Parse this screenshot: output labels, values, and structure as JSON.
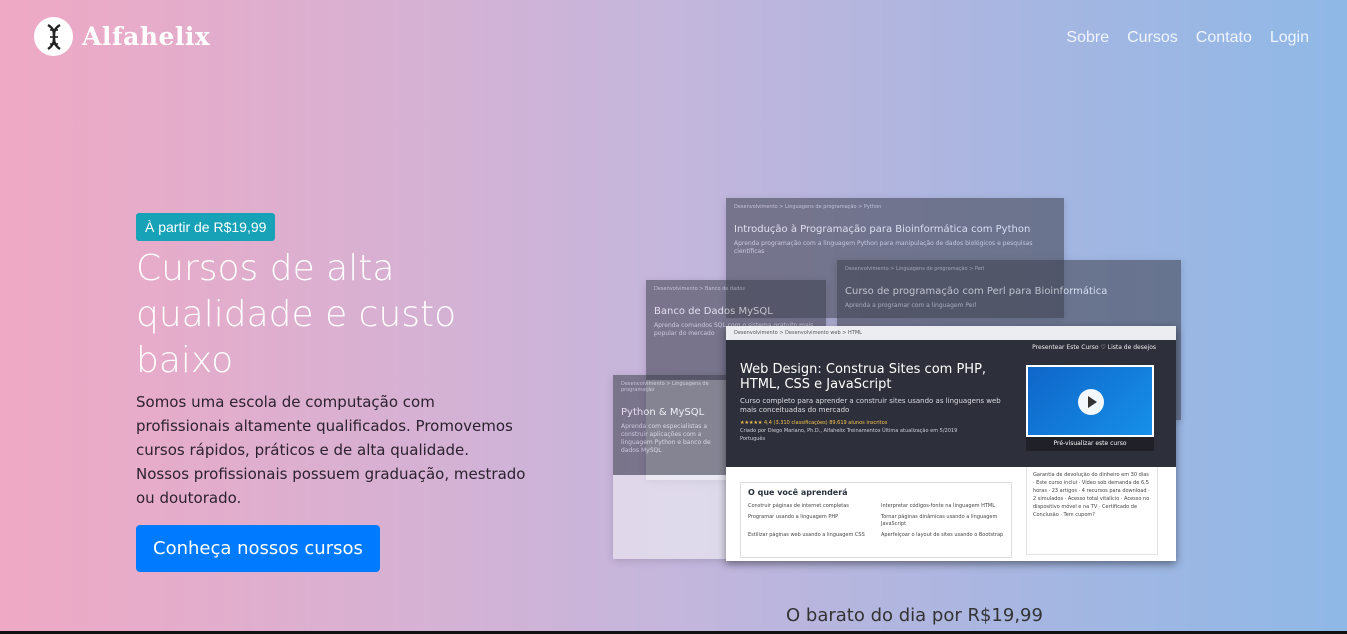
{
  "brand": {
    "name": "Alfahelix",
    "logo_icon": "dna-icon"
  },
  "nav": {
    "items": [
      "Sobre",
      "Cursos",
      "Contato",
      "Login"
    ]
  },
  "hero": {
    "badge": "À partir de R$19,99",
    "title": "Cursos de alta qualidade e custo baixo",
    "description": "Somos uma escola de computação com profissionais altamente qualificados. Promovemos cursos rápidos, práticos e de alta qualidade. Nossos profissionais possuem graduação, mestrado ou doutorado.",
    "cta_label": "Conheça nossos cursos",
    "cta_color": "#007bff",
    "badge_color": "#17a2b8"
  },
  "collage": {
    "cards": [
      {
        "crumb": "Desenvolvimento  >  Linguagens de programação  >  Python",
        "title": "Introdução à Programação para Bioinformática com Python",
        "subtitle": "Aprenda programação com a linguagem Python para manipulação de dados biológicos e pesquisas científicas"
      },
      {
        "crumb": "Desenvolvimento  >  Linguagens de programação  >  Perl",
        "title": "Curso de programação com Perl para Bioinformática",
        "subtitle": "Aprenda a programar com a linguagem Perl"
      },
      {
        "crumb": "Desenvolvimento  >  Banco de dados",
        "title": "Banco de Dados MySQL",
        "subtitle": "Aprenda comandos SQL com o sistema gratuito mais popular do mercado"
      },
      {
        "crumb": "Desenvolvimento  >  Linguagens de programação",
        "title": "Python & MySQL",
        "subtitle": "Aprenda com especialistas a construir aplicações com a linguagem Python e banco de dados MySQL"
      }
    ],
    "main": {
      "crumb": "Desenvolvimento  >  Desenvolvimento web  >  HTML",
      "actions": "Presentear Este Curso   ♡ Lista de desejos",
      "title": "Web Design: Construa Sites com PHP, HTML, CSS e JavaScript",
      "subtitle": "Curso completo para aprender a construir sites usando as linguagens web mais conceituadas do mercado",
      "rating": "★★★★★ 4,4 (3.310 classificações)   89.619 alunos inscritos",
      "author": "Criado por Diego Mariano, Ph.D., Alfahelix Treinamentos   Última atualização em 5/2019",
      "language": "Português",
      "preview": "Pré-visualizar este curso",
      "learn_title": "O que você aprenderá",
      "learn_items": [
        "Construir páginas de internet completas",
        "Interpretar códigos-fonte na linguagem HTML",
        "Programar usando a linguagem PHP",
        "Tornar páginas dinâmicas usando a linguagem JavaScript",
        "Estilizar páginas web usando a linguagem CSS",
        "Aperfeiçoar o layout de sites usando o Bootstrap"
      ],
      "side_text": "Garantia de devolução do dinheiro em 30 dias · Este curso inclui · Vídeo sob demanda de 6,5 horas · 23 artigos · 4 recursos para download · 2 simulados · Acesso total vitalício · Acesso no dispositivo móvel e na TV · Certificado de Conclusão · Tem cupom?"
    }
  },
  "deal_text": "O barato do dia por R$19,99"
}
